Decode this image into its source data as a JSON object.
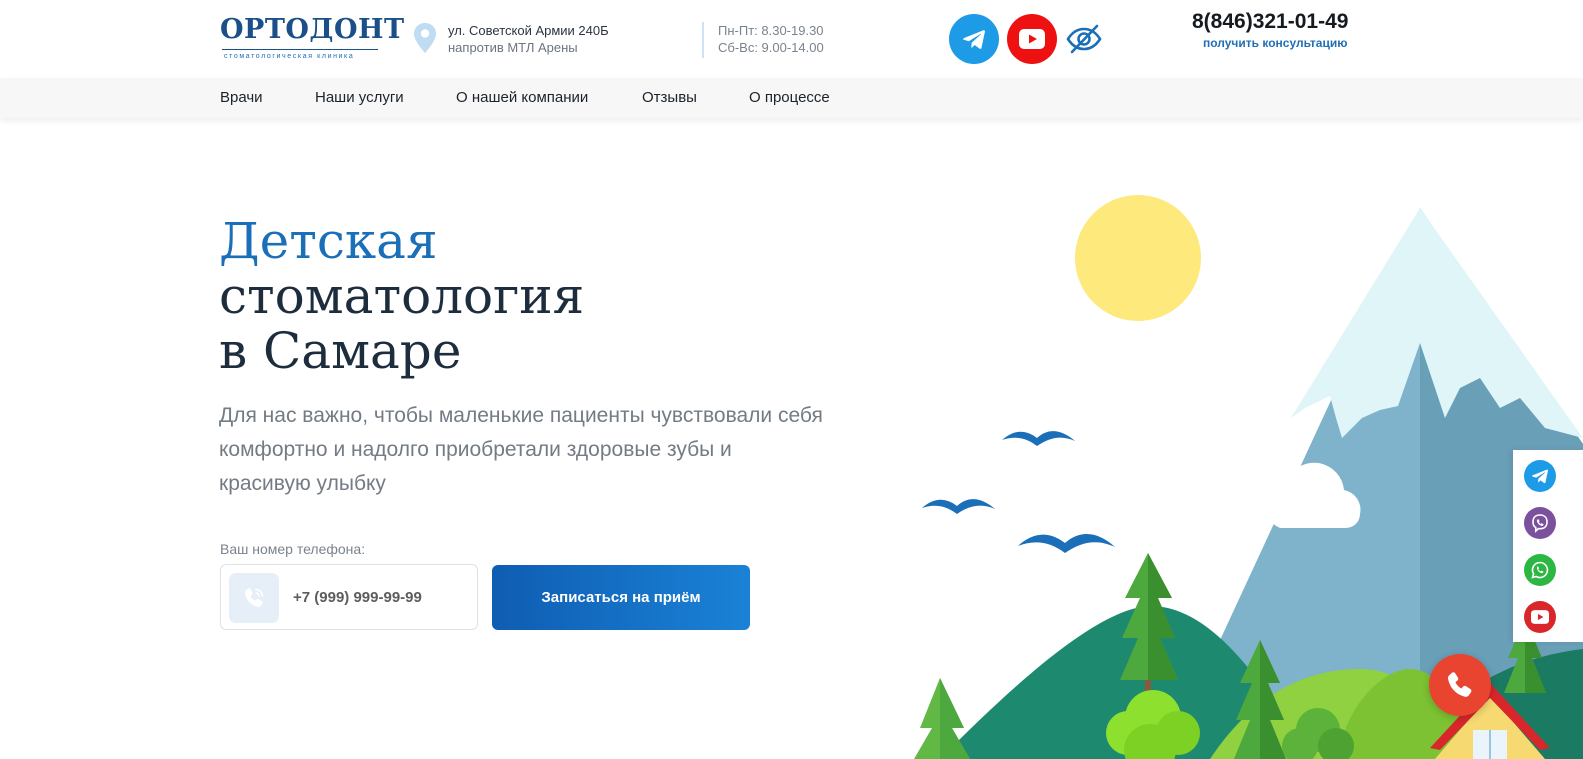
{
  "header": {
    "logo": {
      "name": "ОРТОДОНТ",
      "subtitle": "стоматологическая клиника"
    },
    "address": {
      "line1": "ул. Советской Армии 240Б",
      "line2": "напротив МТЛ Арены"
    },
    "schedule": {
      "line1": "Пн-Пт: 8.30-19.30",
      "line2": "Сб-Вс: 9.00-14.00"
    },
    "social": [
      {
        "icon": "telegram-icon",
        "color": "#1d9be6"
      },
      {
        "icon": "youtube-icon",
        "color": "#ee1111"
      }
    ],
    "accessibility_icon": "eye-slash-icon",
    "phone": "8(846)321-01-49",
    "consult_link": "получить консультацию"
  },
  "nav": {
    "items": [
      {
        "label": "Врачи"
      },
      {
        "label": "Наши услуги"
      },
      {
        "label": "О нашей компании"
      },
      {
        "label": "Отзывы"
      },
      {
        "label": "О процессе"
      }
    ]
  },
  "hero": {
    "title_accent": "Детская",
    "title_line2": "стоматология",
    "title_line3": "в Самаре",
    "lead": "Для нас важно, чтобы маленькие пациенты чувствовали себя комфортно и надолго приобретали здоровые зубы и красивую улыбку",
    "phone_label": "Ваш номер телефона:",
    "phone_placeholder": "+7 (999) 999-99-99",
    "cta_label": "Записаться на приём"
  },
  "side_social": [
    {
      "icon": "telegram-icon",
      "color": "#1d9be6"
    },
    {
      "icon": "viber-icon",
      "color": "#7b519d"
    },
    {
      "icon": "whatsapp-icon",
      "color": "#2bb741"
    },
    {
      "icon": "youtube-icon",
      "color": "#d9262b"
    }
  ],
  "colors": {
    "brand": "#1a4f8a",
    "accent": "#1a6fb8",
    "cta": "#1470c4",
    "call": "#e8442f"
  }
}
